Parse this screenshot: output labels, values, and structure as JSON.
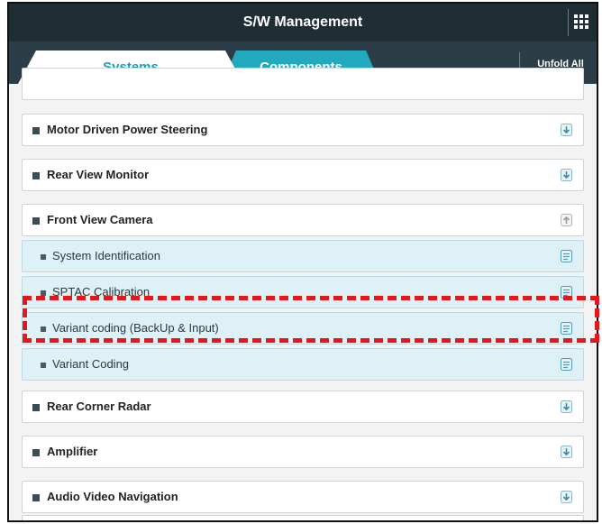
{
  "header": {
    "title": "S/W Management",
    "menu_icon": "grid-menu-icon"
  },
  "tabs": [
    {
      "label": "Systems",
      "active": true
    },
    {
      "label": "Components",
      "active": false
    }
  ],
  "unfold_all_label": "Unfold All",
  "list": [
    {
      "label": "Motor Driven Power Steering",
      "type": "system",
      "icon": "expand-icon"
    },
    {
      "label": "Rear View Monitor",
      "type": "system",
      "icon": "expand-icon"
    },
    {
      "label": "Front View Camera",
      "type": "system",
      "icon": "collapse-icon",
      "expanded": true
    },
    {
      "label": "System Identification",
      "type": "function",
      "icon": "document-icon"
    },
    {
      "label": "SPTAC Calibration",
      "type": "function",
      "icon": "document-icon"
    },
    {
      "label": "Variant coding (BackUp & Input)",
      "type": "function",
      "icon": "document-icon",
      "highlighted": true
    },
    {
      "label": "Variant Coding",
      "type": "function",
      "icon": "document-icon"
    },
    {
      "label": "Rear Corner Radar",
      "type": "system",
      "icon": "expand-icon"
    },
    {
      "label": "Amplifier",
      "type": "system",
      "icon": "expand-icon"
    },
    {
      "label": "Audio Video Navigation",
      "type": "system",
      "icon": "expand-icon"
    }
  ],
  "colors": {
    "title_bar": "#1f2d35",
    "tab_bar": "#2b3d47",
    "active_tab_text": "#1a9fb8",
    "inactive_tab": "#22a9be",
    "child_row": "#ddf1f6",
    "highlight": "#e8161b"
  }
}
